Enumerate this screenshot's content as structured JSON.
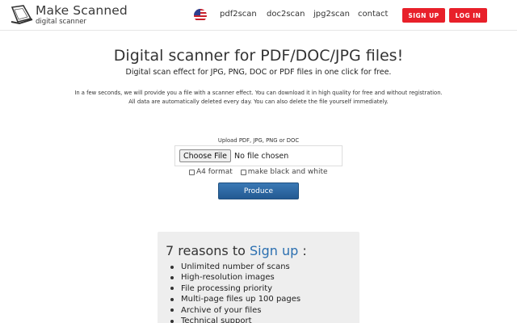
{
  "header": {
    "logo_title": "Make Scanned",
    "logo_subtitle": "digital scanner",
    "language_icon": "us-flag-icon",
    "nav": [
      "pdf2scan",
      "doc2scan",
      "jpg2scan",
      "contact"
    ],
    "signup_label": "SIGN UP",
    "login_label": "LOG IN",
    "accent_color": "#e8202a"
  },
  "main": {
    "title": "Digital scanner for PDF/DOC/JPG files!",
    "subtitle": "Digital scan effect for JPG, PNG, DOC or PDF files in one click for free.",
    "info_line1": "In a few seconds, we will provide you a file with a scanner effect. You can download it in high quality for free and without registration.",
    "info_line2": "All data are automatically deleted every day. You can also delete the file yourself immediately.",
    "upload_label": "Upload PDF, JPG, PNG or DOC",
    "choose_file_label": "Choose File",
    "file_status": "No file chosen",
    "option_a4": "A4 format",
    "option_bw": "make black and white",
    "produce_label": "Produce",
    "produce_color": "#2b66a0"
  },
  "reasons": {
    "title_prefix": "7 reasons to ",
    "title_link": "Sign up",
    "title_suffix": " :",
    "items": [
      "Unlimited number of scans",
      "High-resolution images",
      "File processing priority",
      "Multi-page files up 100 pages",
      "Archive of your files",
      "Technical support"
    ]
  }
}
